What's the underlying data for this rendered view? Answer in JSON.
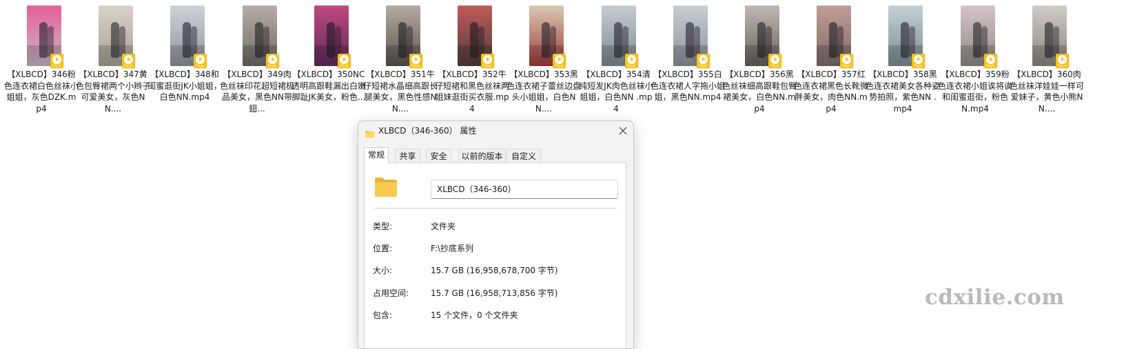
{
  "files": [
    {
      "name": "【XLBCD】346粉色连衣裙白色丝袜小姐姐，灰色DZK.mp4",
      "colors": [
        "#c9b7c4",
        "#e65f9a"
      ]
    },
    {
      "name": "【XLBCD】347黄色包臀裙两个小辫子可爱美女，灰色NN....",
      "colors": [
        "#a7a197",
        "#d8d2c8"
      ]
    },
    {
      "name": "【XLBCD】348和闺蜜逛街JK小姐姐，白色NN.mp4",
      "colors": [
        "#8c949a",
        "#cfd3d6"
      ]
    },
    {
      "name": "【XLBCD】349肉色丝袜印花超短裙极品美女，黑色NN带翅...",
      "colors": [
        "#6f6a66",
        "#b6aea5"
      ]
    },
    {
      "name": "【XLBCD】350NC透明高跟鞋漏出白嫩脚趾JK美女，粉色...",
      "colors": [
        "#5e2c5c",
        "#c0487f"
      ]
    },
    {
      "name": "【XLBCD】351牛仔短裙水晶细高跟长腿美女，黑色性感NN....",
      "colors": [
        "#5b5450",
        "#b4aaa0"
      ]
    },
    {
      "name": "【XLBCD】352牛仔短裙和黑色丝袜两姐妹逛街买衣服.mp4",
      "colors": [
        "#4e3e3a",
        "#c35a5a"
      ]
    },
    {
      "name": "【XLBCD】353黑色连衣裙子蕾丝边盘头小姐姐，白色NN....",
      "colors": [
        "#a03b3b",
        "#d8c9b3"
      ]
    },
    {
      "name": "【XLBCD】354清纯短发JK肉色丝袜小姐姐，白色NN .mp4",
      "colors": [
        "#7d8a93",
        "#c5ccd1"
      ]
    },
    {
      "name": "【XLBCD】355白色连衣裙人字拖小姐姐，黑色NN.mp4",
      "colors": [
        "#8d9398",
        "#c9ced2"
      ]
    },
    {
      "name": "【XLBCD】356黑色丝袜细高跟鞋包臀裙美女，白色NN.mp4",
      "colors": [
        "#66615e",
        "#bfb8b2"
      ]
    },
    {
      "name": "【XLBCD】357红色连衣裙黑色长靴微胖美女，肉色NN.mp4",
      "colors": [
        "#7a6c6a",
        "#c39d95"
      ]
    },
    {
      "name": "【XLBCD】358黑色连衣裙美女各种姿势拍照，紫色NN .mp4",
      "colors": [
        "#7b8d94",
        "#c5d0d4"
      ]
    },
    {
      "name": "【XLBCD】359粉色连衣裙小姐诶将诶和闺蜜逛街，粉色N.mp4",
      "colors": [
        "#8e8a86",
        "#d4c3c8"
      ]
    },
    {
      "name": "【XLBCD】360肉色丝袜洋娃娃一样可爱妹子，黄色小熊NN....",
      "colors": [
        "#8a8580",
        "#d1ccc6"
      ]
    }
  ],
  "badge_text": "Player",
  "dialog": {
    "title": "XLBCD（346-360） 属性",
    "tabs": [
      "常规",
      "共享",
      "安全",
      "以前的版本",
      "自定义"
    ],
    "active_tab": 0,
    "folder_name": "XLBCD（346-360）",
    "properties": [
      {
        "label": "类型:",
        "value": "文件夹"
      },
      {
        "label": "位置:",
        "value": "F:\\抄底系列"
      },
      {
        "label": "大小:",
        "value": "15.7 GB (16,958,678,700 字节)"
      },
      {
        "label": "占用空间:",
        "value": "15.7 GB (16,958,713,856 字节)"
      },
      {
        "label": "包含:",
        "value": "15 个文件，0 个文件夹"
      }
    ]
  },
  "watermark": "cdxilie.com",
  "colors": {
    "badge_yellow": "#f4c21a",
    "folder_yellow": "#f6c544",
    "dialog_bg": "#f3f3f3"
  }
}
